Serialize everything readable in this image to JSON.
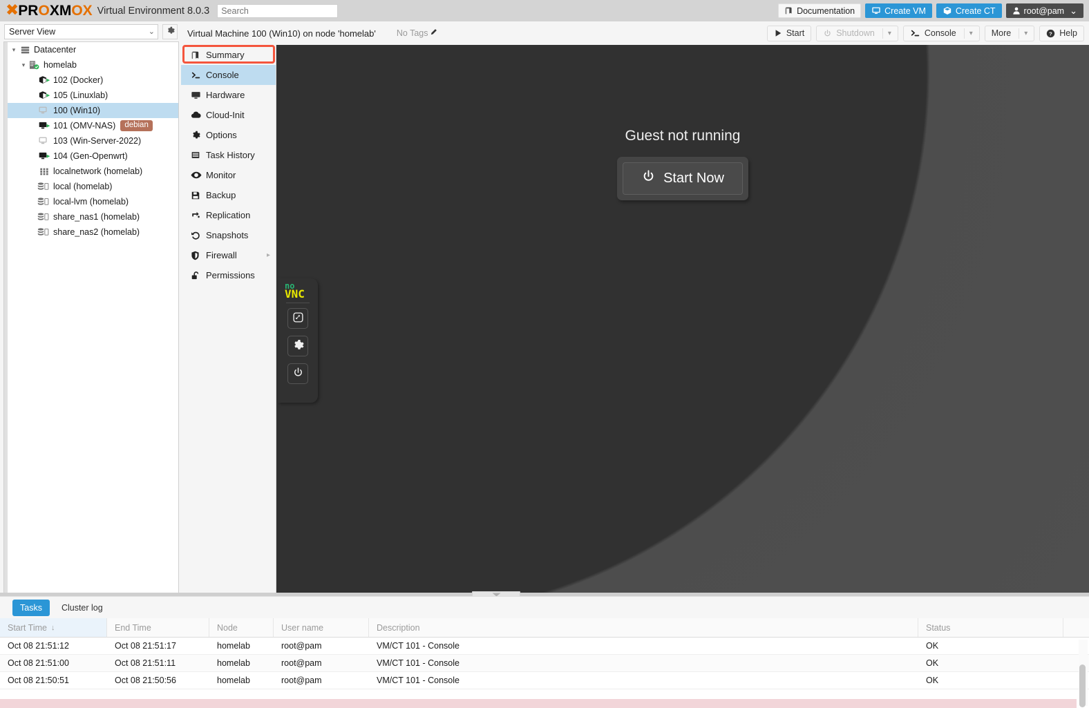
{
  "header": {
    "logo_parts": [
      "PR",
      "O",
      "XM",
      "O",
      "X"
    ],
    "product": "Virtual Environment 8.0.3",
    "search_placeholder": "Search",
    "search_value": "",
    "buttons": [
      {
        "label": "Documentation",
        "icon": "book-icon",
        "style": "light"
      },
      {
        "label": "Create VM",
        "icon": "monitor-icon",
        "style": "blue"
      },
      {
        "label": "Create CT",
        "icon": "container-icon",
        "style": "blue"
      },
      {
        "label": "root@pam",
        "icon": "user-icon",
        "style": "dark",
        "caret": "⌄"
      }
    ]
  },
  "sidebar": {
    "view_selector": {
      "value": "Server View",
      "chevron": "⌄"
    },
    "settings_icon": "gear-icon",
    "tree": [
      {
        "label": "Datacenter",
        "icon": "datacenter-icon",
        "indent": 0,
        "twisty": "⌄",
        "selected": false
      },
      {
        "label": "homelab",
        "icon": "node-icon",
        "indent": 1,
        "twisty": "⌄",
        "selected": false
      },
      {
        "label": "102 (Docker)",
        "icon": "container-running-icon",
        "indent": 2,
        "twisty": "",
        "selected": false
      },
      {
        "label": "105 (Linuxlab)",
        "icon": "container-running-icon",
        "indent": 2,
        "twisty": "",
        "selected": false
      },
      {
        "label": "100 (Win10)",
        "icon": "vm-stopped-icon",
        "indent": 2,
        "twisty": "",
        "selected": true
      },
      {
        "label": "101 (OMV-NAS)",
        "icon": "vm-running-icon",
        "indent": 2,
        "twisty": "",
        "selected": false,
        "tag": "debian"
      },
      {
        "label": "103 (Win-Server-2022)",
        "icon": "vm-stopped-icon",
        "indent": 2,
        "twisty": "",
        "selected": false
      },
      {
        "label": "104 (Gen-Openwrt)",
        "icon": "vm-running-icon",
        "indent": 2,
        "twisty": "",
        "selected": false
      },
      {
        "label": "localnetwork (homelab)",
        "icon": "network-icon",
        "indent": 2,
        "twisty": "",
        "selected": false
      },
      {
        "label": "local (homelab)",
        "icon": "storage-icon",
        "indent": 2,
        "twisty": "",
        "selected": false
      },
      {
        "label": "local-lvm (homelab)",
        "icon": "storage-icon",
        "indent": 2,
        "twisty": "",
        "selected": false
      },
      {
        "label": "share_nas1 (homelab)",
        "icon": "storage-icon",
        "indent": 2,
        "twisty": "",
        "selected": false
      },
      {
        "label": "share_nas2 (homelab)",
        "icon": "storage-icon",
        "indent": 2,
        "twisty": "",
        "selected": false
      }
    ]
  },
  "content": {
    "title": "Virtual Machine 100 (Win10) on node 'homelab'",
    "tags_label": "No Tags",
    "tags_edit_icon": "pencil-icon",
    "toolbar": [
      {
        "label": "Start",
        "icon": "play-icon",
        "disabled": false,
        "split": false
      },
      {
        "label": "Shutdown",
        "icon": "power-icon",
        "disabled": true,
        "split": true
      },
      {
        "label": "Console",
        "icon": "terminal-icon",
        "disabled": false,
        "split": true
      },
      {
        "label": "More",
        "icon": "",
        "disabled": false,
        "split": true
      },
      {
        "label": "Help",
        "icon": "help-icon",
        "disabled": false,
        "split": false
      }
    ],
    "nav": [
      {
        "label": "Summary",
        "icon": "summary-icon",
        "active": false,
        "submenu": false
      },
      {
        "label": "Console",
        "icon": "terminal-icon",
        "active": true,
        "submenu": false
      },
      {
        "label": "Hardware",
        "icon": "monitor-icon",
        "active": false,
        "submenu": false
      },
      {
        "label": "Cloud-Init",
        "icon": "cloud-icon",
        "active": false,
        "submenu": false
      },
      {
        "label": "Options",
        "icon": "gear-icon",
        "active": false,
        "submenu": false
      },
      {
        "label": "Task History",
        "icon": "list-icon",
        "active": false,
        "submenu": false
      },
      {
        "label": "Monitor",
        "icon": "eye-icon",
        "active": false,
        "submenu": false
      },
      {
        "label": "Backup",
        "icon": "floppy-icon",
        "active": false,
        "submenu": false
      },
      {
        "label": "Replication",
        "icon": "replication-icon",
        "active": false,
        "submenu": false
      },
      {
        "label": "Snapshots",
        "icon": "history-icon",
        "active": false,
        "submenu": false
      },
      {
        "label": "Firewall",
        "icon": "shield-icon",
        "active": false,
        "submenu": true,
        "arrow": "▸"
      },
      {
        "label": "Permissions",
        "icon": "unlock-icon",
        "active": false,
        "submenu": false
      }
    ]
  },
  "console": {
    "novnc_logo_top": "no",
    "novnc_logo_bottom": "VNC",
    "panel_buttons": [
      {
        "name": "fullscreen-button",
        "icon": "expand-icon"
      },
      {
        "name": "settings-button",
        "icon": "gear-icon"
      },
      {
        "name": "power-button",
        "icon": "power-icon"
      }
    ],
    "guest_message": "Guest not running",
    "start_now_label": "Start Now",
    "start_now_icon": "power-icon"
  },
  "bottom": {
    "tabs": [
      {
        "label": "Tasks",
        "active": true
      },
      {
        "label": "Cluster log",
        "active": false
      }
    ],
    "columns": [
      {
        "label": "Start Time",
        "key": "start",
        "sorted": true,
        "sort_arrow": "↓"
      },
      {
        "label": "End Time",
        "key": "end",
        "sorted": false,
        "sort_arrow": ""
      },
      {
        "label": "Node",
        "key": "node",
        "sorted": false,
        "sort_arrow": ""
      },
      {
        "label": "User name",
        "key": "user",
        "sorted": false,
        "sort_arrow": ""
      },
      {
        "label": "Description",
        "key": "desc",
        "sorted": false,
        "sort_arrow": ""
      },
      {
        "label": "Status",
        "key": "status",
        "sorted": false,
        "sort_arrow": ""
      }
    ],
    "rows": [
      {
        "start": "Oct 08 21:51:12",
        "end": "Oct 08 21:51:17",
        "node": "homelab",
        "user": "root@pam",
        "desc": "VM/CT 101 - Console",
        "status": "OK"
      },
      {
        "start": "Oct 08 21:51:00",
        "end": "Oct 08 21:51:11",
        "node": "homelab",
        "user": "root@pam",
        "desc": "VM/CT 101 - Console",
        "status": "OK"
      },
      {
        "start": "Oct 08 21:50:51",
        "end": "Oct 08 21:50:56",
        "node": "homelab",
        "user": "root@pam",
        "desc": "VM/CT 101 - Console",
        "status": "OK"
      }
    ]
  },
  "colors": {
    "brand_orange": "#e57000",
    "accent_blue": "#2b96d6",
    "selection_blue": "#bedcf0",
    "highlight_red": "#f4553d",
    "tag_brown": "#b5715a",
    "console_bg": "#313131"
  }
}
